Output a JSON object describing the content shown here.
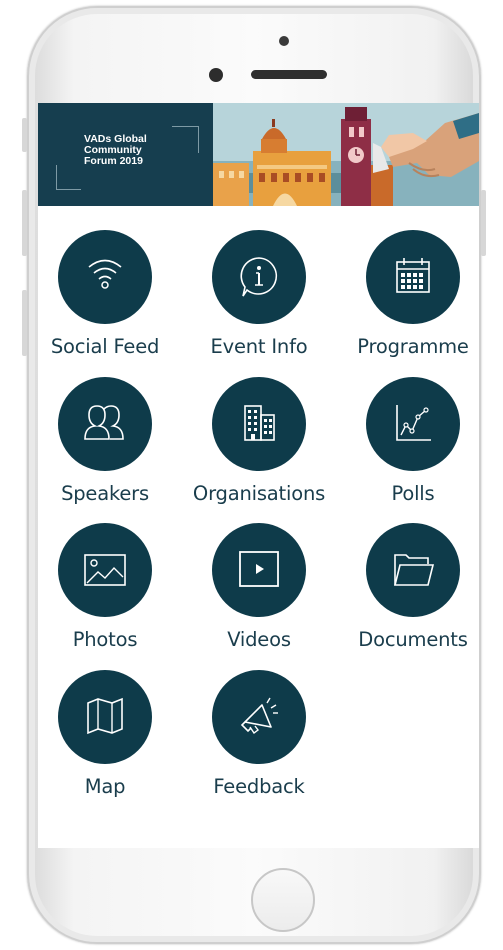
{
  "banner": {
    "title_line1": "VADs Global",
    "title_line2": "Community",
    "title_line3": "Forum 2019"
  },
  "menu": [
    {
      "label": "Social Feed",
      "icon": "wifi-icon"
    },
    {
      "label": "Event Info",
      "icon": "info-icon"
    },
    {
      "label": "Programme",
      "icon": "calendar-icon"
    },
    {
      "label": "Speakers",
      "icon": "people-icon"
    },
    {
      "label": "Organisations",
      "icon": "building-icon"
    },
    {
      "label": "Polls",
      "icon": "chart-icon"
    },
    {
      "label": "Photos",
      "icon": "image-icon"
    },
    {
      "label": "Videos",
      "icon": "video-play-icon"
    },
    {
      "label": "Documents",
      "icon": "folder-icon"
    },
    {
      "label": "Map",
      "icon": "map-icon"
    },
    {
      "label": "Feedback",
      "icon": "megaphone-icon"
    }
  ],
  "colors": {
    "tile": "#0e3b4a",
    "banner_dark": "#163e4f",
    "label": "#1a3d4c"
  }
}
